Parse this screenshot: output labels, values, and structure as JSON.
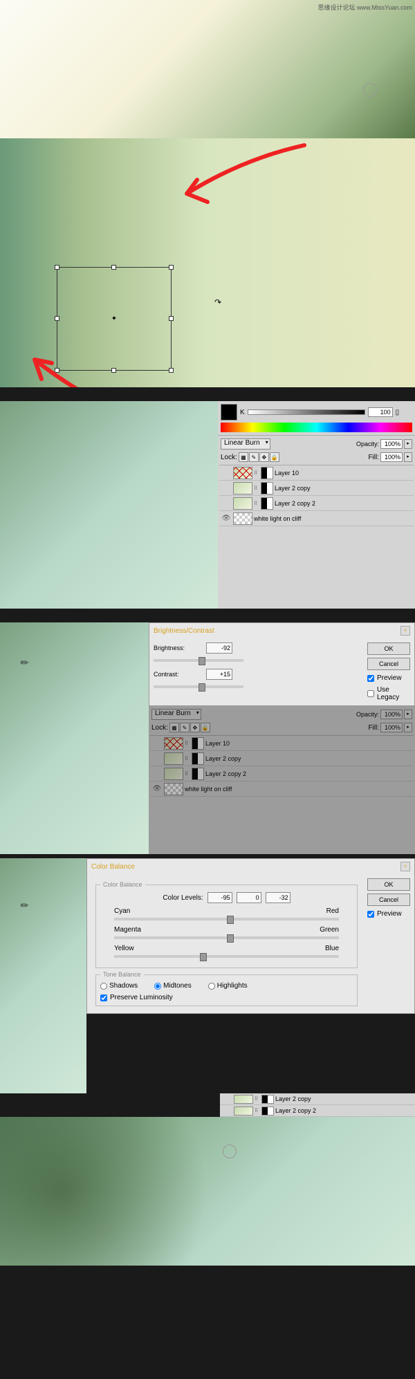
{
  "watermark": "思缘设计论坛 www.MissYuan.com",
  "color": {
    "k_label": "K",
    "k_value": "100",
    "ink_icon": "▯"
  },
  "layers": {
    "blend_mode": "Linear Burn",
    "opacity_label": "Opacity:",
    "opacity_value": "100%",
    "lock_label": "Lock:",
    "fill_label": "Fill:",
    "fill_value": "100%",
    "items": [
      {
        "name": "Layer 10"
      },
      {
        "name": "Layer 2 copy"
      },
      {
        "name": "Layer 2 copy 2"
      },
      {
        "name": "white light on cliff"
      }
    ]
  },
  "brightness": {
    "title": "Brightness/Contrast",
    "brightness_label": "Brightness:",
    "brightness_value": "-92",
    "contrast_label": "Contrast:",
    "contrast_value": "+15",
    "ok": "OK",
    "cancel": "Cancel",
    "preview": "Preview",
    "legacy": "Use Legacy"
  },
  "colorbalance": {
    "title": "Color Balance",
    "section_label": "Color Balance",
    "levels_label": "Color Levels:",
    "v1": "-95",
    "v2": "0",
    "v3": "-32",
    "left": [
      "Cyan",
      "Magenta",
      "Yellow"
    ],
    "right": [
      "Red",
      "Green",
      "Blue"
    ],
    "tone_label": "Tone Balance",
    "shadows": "Shadows",
    "midtones": "Midtones",
    "highlights": "Highlights",
    "preserve": "Preserve Luminosity",
    "ok": "OK",
    "cancel": "Cancel",
    "preview": "Preview"
  },
  "layers_partial": {
    "items": [
      {
        "name": "Layer 2 copy"
      },
      {
        "name": "Layer 2 copy 2"
      }
    ]
  }
}
